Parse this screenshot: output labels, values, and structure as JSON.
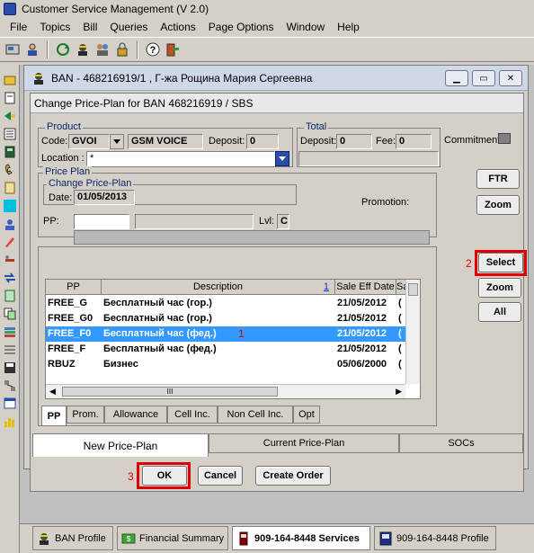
{
  "app": {
    "title": "Customer Service Management  (V 2.0)"
  },
  "menu": [
    "File",
    "Topics",
    "Bill",
    "Queries",
    "Actions",
    "Page Options",
    "Window",
    "Help"
  ],
  "ban_window": {
    "title": "BAN - 468216919/1 , Г-жа Рощина Мария Сергеевна"
  },
  "dialog": {
    "title": "Change Price-Plan for BAN 468216919 / SBS",
    "product": {
      "label": "Product",
      "code_label": "Code:",
      "code": "GVOI",
      "name": "GSM VOICE",
      "deposit_label": "Deposit:",
      "deposit": "0",
      "location_label": "Location :",
      "location": "*"
    },
    "total": {
      "label": "Total",
      "deposit_label": "Deposit:",
      "deposit": "0",
      "fee_label": "Fee:",
      "fee": "0"
    },
    "commitment_label": "Commitment",
    "price_plan": {
      "label": "Price Plan",
      "change_label": "Change Price-Plan",
      "date_label": "Date:",
      "date": "01/05/2013",
      "promotion_label": "Promotion:",
      "pp_label": "PP:",
      "lvl_label": "Lvl:",
      "lvl": "C"
    },
    "buttons": {
      "ftr": "FTR",
      "zoom1": "Zoom",
      "select": "Select",
      "zoom2": "Zoom",
      "all": "All",
      "ok": "OK",
      "cancel": "Cancel",
      "create_order": "Create Order"
    },
    "grid": {
      "headers": [
        "PP",
        "Description",
        "Sale Eff Date",
        "Sa"
      ],
      "sort_marker": "1",
      "rows": [
        {
          "pp": "FREE_G",
          "desc": "Бесплатный час (гор.)",
          "date": "21/05/2012",
          "s": "("
        },
        {
          "pp": "FREE_G0",
          "desc": "Бесплатный час (гор.)",
          "date": "21/05/2012",
          "s": "("
        },
        {
          "pp": "FREE_F0",
          "desc": "Бесплатный час (фед.)",
          "date": "21/05/2012",
          "s": "("
        },
        {
          "pp": "FREE_F",
          "desc": "Бесплатный час (фед.)",
          "date": "21/05/2012",
          "s": "("
        },
        {
          "pp": "RBUZ",
          "desc": "Бизнес",
          "date": "05/06/2000",
          "s": "("
        }
      ],
      "scroll_grip": "III"
    },
    "tabs": [
      "PP",
      "Prom.",
      "Allowance",
      "Cell Inc.",
      "Non Cell Inc.",
      "Opt"
    ],
    "bottom_tabs": [
      "New Price-Plan",
      "Current Price-Plan",
      "SOCs"
    ],
    "markers": {
      "m1": "1",
      "m2": "2",
      "m3": "3"
    }
  },
  "bottom_bar": [
    "BAN Profile",
    "Financial Summary",
    "909-164-8448 Services",
    "909-164-8448 Profile"
  ]
}
